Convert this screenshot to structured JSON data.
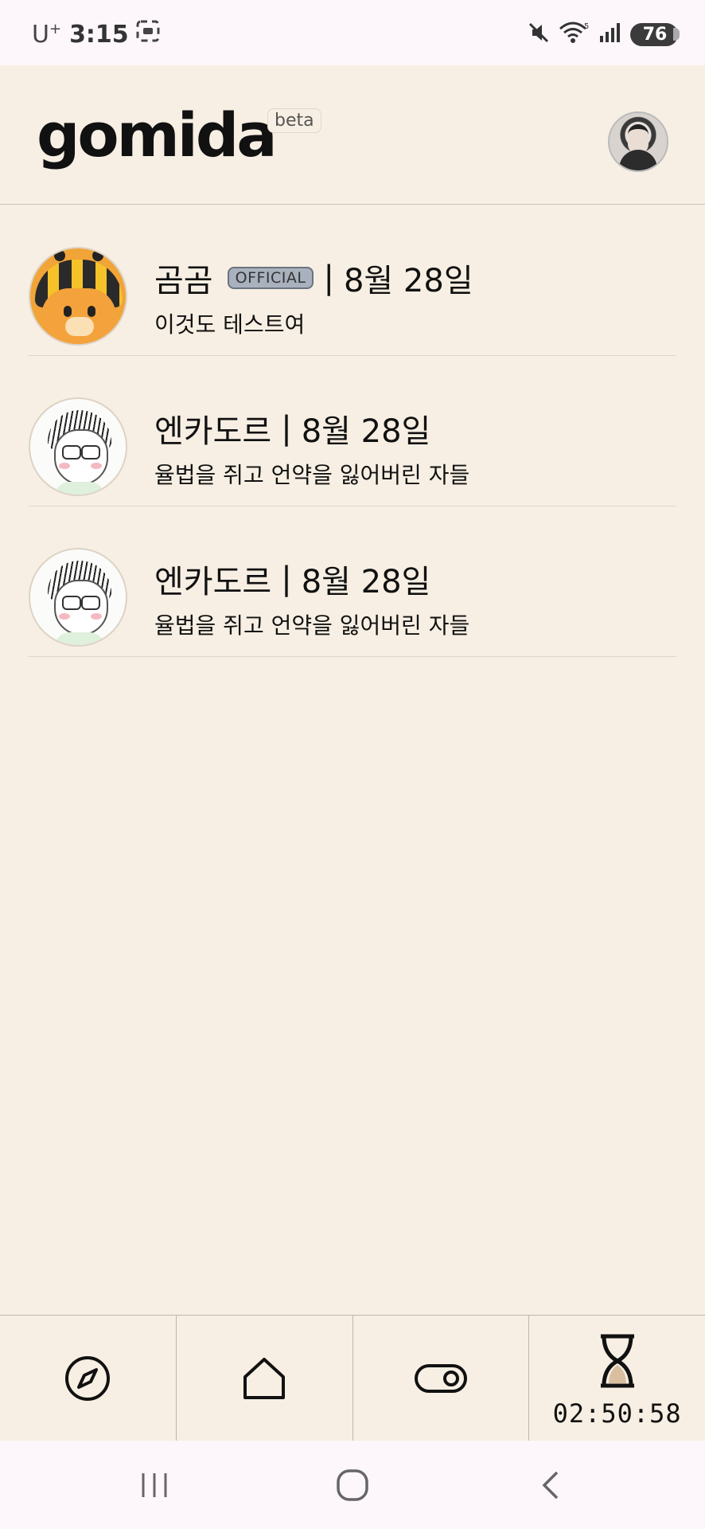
{
  "status_bar": {
    "carrier": "U",
    "carrier_sup": "+",
    "time": "3:15",
    "battery": "76"
  },
  "header": {
    "logo": "gomida",
    "badge": "beta"
  },
  "feed": {
    "posts": [
      {
        "author": "곰곰",
        "official_badge": "OFFICIAL",
        "separator": "|",
        "date": "8월 28일",
        "text": "이것도 테스트여",
        "avatar": "bear-bee-avatar"
      },
      {
        "author": "엔카도르",
        "separator": "|",
        "date": "8월 28일",
        "text": "율법을 쥐고 언약을 잃어버린 자들",
        "avatar": "sketch-glasses-avatar"
      },
      {
        "author": "엔카도르",
        "separator": "|",
        "date": "8월 28일",
        "text": "율법을 쥐고 언약을 잃어버린 자들",
        "avatar": "sketch-glasses-avatar"
      }
    ]
  },
  "bottom_nav": {
    "items": [
      {
        "icon": "compass-icon"
      },
      {
        "icon": "home-icon"
      },
      {
        "icon": "toggle-icon"
      },
      {
        "icon": "hourglass-icon",
        "timer": "02:50:58"
      }
    ]
  },
  "system_nav": {
    "icons": [
      "recent-apps-icon",
      "home-circle-icon",
      "back-chevron-icon"
    ]
  }
}
